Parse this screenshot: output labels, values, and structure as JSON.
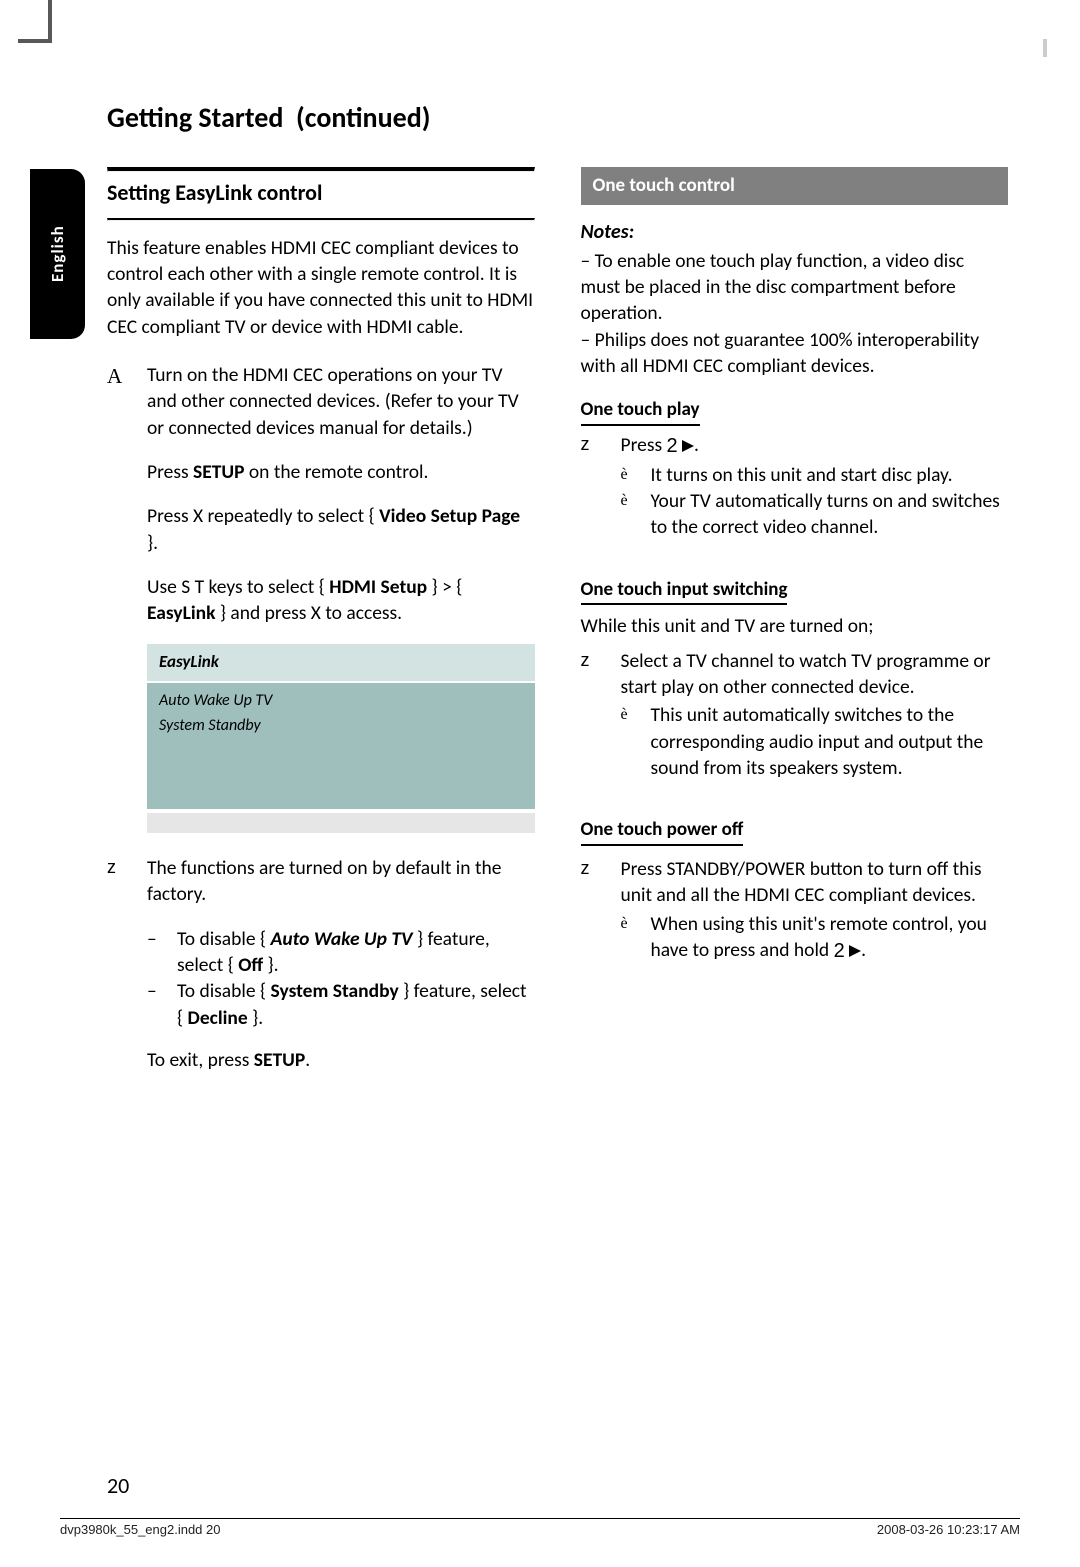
{
  "side_tab": "English",
  "title_a": "Getting Started",
  "title_b": "(continued)",
  "section_heading": "Setting EasyLink control",
  "intro": "This feature enables HDMI CEC compliant devices to control each other with a single remote control. It is only available if you have connected this unit to HDMI CEC compliant TV or device with HDMI cable.",
  "step1_num": "A",
  "step1": "Turn on the HDMI CEC operations on your TV and other connected devices. (Refer to your TV or connected devices manual for details.)",
  "step2_a": "Press ",
  "step2_b": "SETUP",
  "step2_c": " on the remote control.",
  "step3_a": "Press  X repeatedly to select { ",
  "step3_b": "Video Setup Page",
  "step3_c": " }.",
  "step4_a": "Use  S T keys to select { ",
  "step4_b": "HDMI Setup",
  "step4_c": " } > { ",
  "step4_d": "EasyLink",
  "step4_e": " } and press  X to access.",
  "setup_title": "EasyLink",
  "setup_row1": "Auto Wake Up TV",
  "setup_row2": "System Standby",
  "default_num": "z",
  "default": "The functions are turned on by default in the factory.",
  "dis1_a": "–",
  "dis1_b": "To disable { ",
  "dis1_c": "Auto Wake Up TV",
  "dis1_d": " } feature, select { ",
  "dis1_e": "Off",
  "dis1_f": " }.",
  "dis2_a": "–",
  "dis2_b": "To disable { ",
  "dis2_c": "System Standby",
  "dis2_d": " } feature, select { ",
  "dis2_e": "Decline",
  "dis2_f": " }.",
  "exit_a": "To exit, press ",
  "exit_b": "SETUP",
  "exit_c": ".",
  "banner": "One touch control",
  "notes_head": "Notes:",
  "note1": "–  To enable one touch play function, a video disc must be placed in the disc compartment before operation.",
  "note2": "–   Philips does not guarantee 100% interoperability with all HDMI CEC compliant devices.",
  "sub1": "One touch play",
  "s1_num": "z",
  "s1_a": "Press ",
  "s1_b": ".",
  "s1_r1": "It turns on this unit and start disc play.",
  "s1_r2": "Your TV automatically turns on and switches to the correct video channel.",
  "sub2": "One touch input switching",
  "s2_intro": "While this unit and TV are turned on;",
  "s2_num": "z",
  "s2_a": "Select a TV channel to watch TV programme or start play on other connected device.",
  "s2_r1": "This unit automatically switches to the corresponding audio input and output the sound from its speakers system.",
  "sub3": "One touch power off",
  "s3_num": "z",
  "s3_a": "Press STANDBY/POWER button to turn off this unit and all the HDMI CEC compliant devices.",
  "s3_r1_a": "When using this unit's remote control, you have to press and hold ",
  "s3_r1_b": ".",
  "page_num": "20",
  "footer_left": "dvp3980k_55_eng2.indd   20",
  "footer_right": "2008-03-26   10:23:17 AM"
}
